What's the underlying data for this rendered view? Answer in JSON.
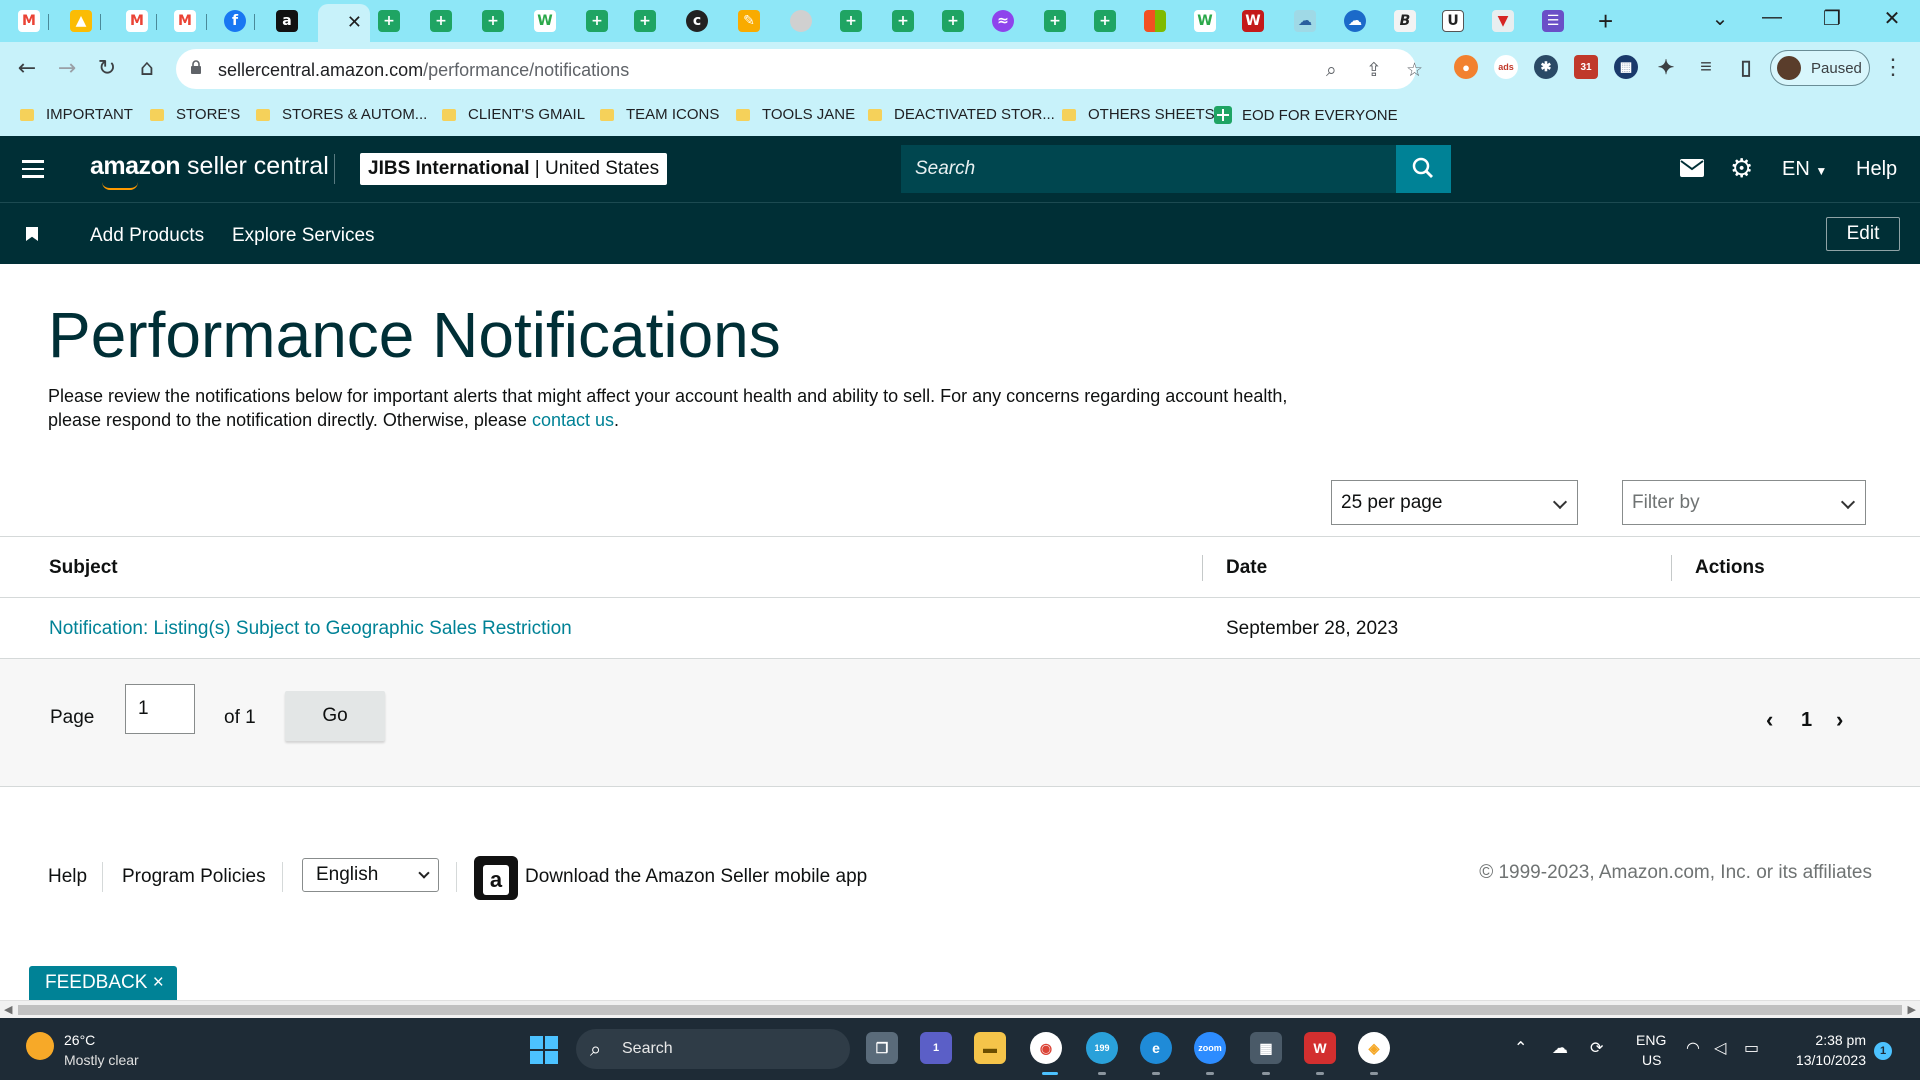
{
  "browser": {
    "url_host": "sellercentral.amazon.com",
    "url_path": "/performance/notifications",
    "profile_label": "Paused",
    "extension_badge": "31"
  },
  "bookmarks": [
    {
      "label": "IMPORTANT",
      "icon": "folder-icon"
    },
    {
      "label": "STORE'S",
      "icon": "folder-icon"
    },
    {
      "label": "STORES & AUTOM...",
      "icon": "folder-icon"
    },
    {
      "label": "CLIENT'S GMAIL",
      "icon": "folder-icon"
    },
    {
      "label": "TEAM ICONS",
      "icon": "folder-icon"
    },
    {
      "label": "TOOLS JANE",
      "icon": "folder-icon"
    },
    {
      "label": "DEACTIVATED STOR...",
      "icon": "folder-icon"
    },
    {
      "label": "OTHERS SHEETS",
      "icon": "folder-icon"
    },
    {
      "label": "EOD FOR EVERYONE",
      "icon": "sheets-icon"
    }
  ],
  "header": {
    "logo_bold": "amazon",
    "logo_rest": " seller central",
    "account_name": "JIBS International",
    "account_region": "United States",
    "search_placeholder": "Search",
    "language": "EN",
    "help": "Help"
  },
  "subnav": {
    "links": [
      "Add Products",
      "Explore Services"
    ],
    "edit": "Edit"
  },
  "main": {
    "title": "Performance Notifications",
    "intro_text": "Please review the notifications below for important alerts that might affect your account health and ability to sell. For any concerns regarding account health, please respond to the notification directly. Otherwise, please ",
    "intro_link": "contact us",
    "intro_end": ".",
    "per_page": "25 per page",
    "filter_placeholder": "Filter by"
  },
  "table": {
    "columns": [
      "Subject",
      "Date",
      "Actions"
    ],
    "rows": [
      {
        "subject": "Notification: Listing(s) Subject to Geographic Sales Restriction",
        "date": "September 28, 2023"
      }
    ]
  },
  "pagination": {
    "page_label": "Page",
    "page_value": "1",
    "of_label": "of 1",
    "go": "Go",
    "current": "1"
  },
  "footer": {
    "help": "Help",
    "program_policies": "Program Policies",
    "language": "English",
    "app_text": "Download the Amazon Seller mobile app",
    "copyright": "© 1999-2023, Amazon.com, Inc. or its affiliates"
  },
  "feedback": "FEEDBACK ×",
  "taskbar": {
    "temp": "26°C",
    "weather": "Mostly clear",
    "search": "Search",
    "lang_top": "ENG",
    "lang_bottom": "US",
    "time": "2:38 pm",
    "date": "13/10/2023",
    "notif_count": "1",
    "teams_badge": "1",
    "telegram_badge": "199"
  },
  "colors": {
    "header_bg": "#002f36",
    "link": "#008296",
    "chrome_bg": "#c8f2fa",
    "tabstrip_bg": "#8ee7f7"
  }
}
